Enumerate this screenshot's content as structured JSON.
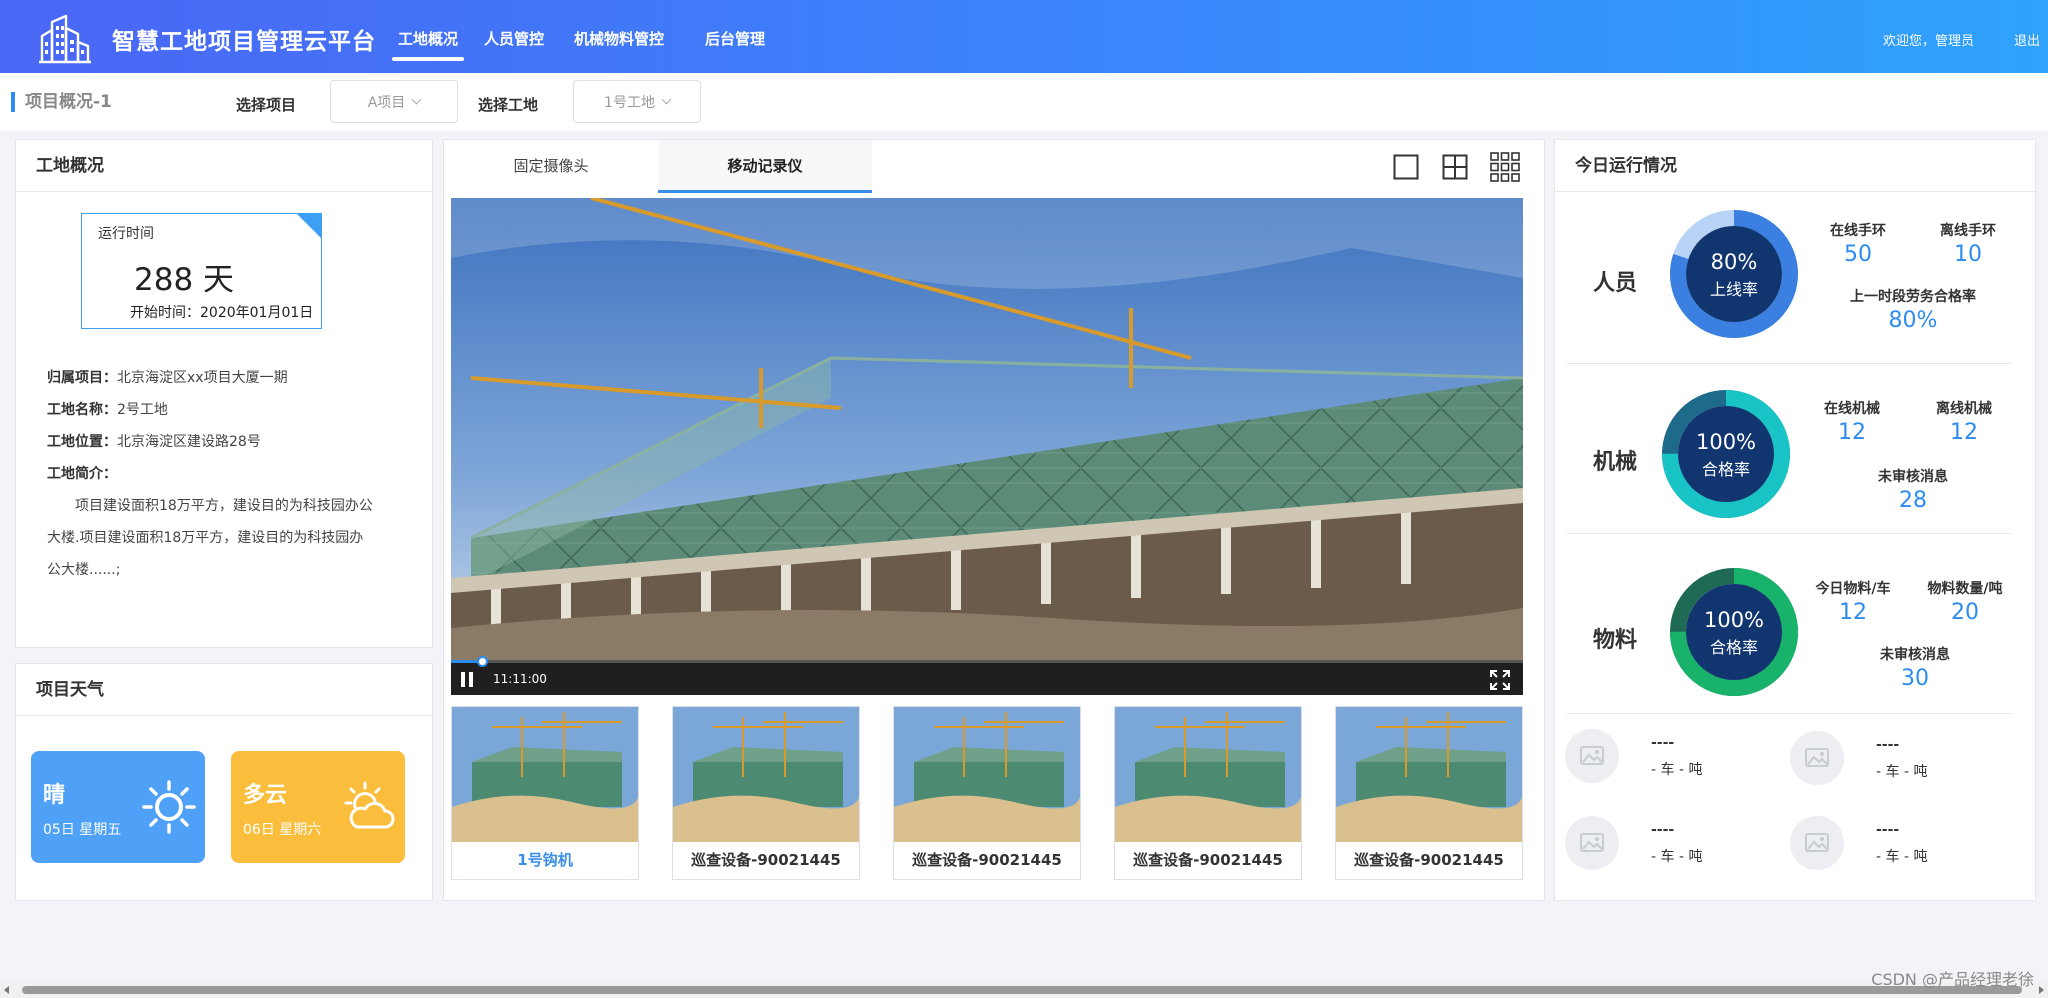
{
  "header": {
    "title": "智慧工地项目管理云平台",
    "nav": [
      "工地概况",
      "人员管控",
      "机械物料管控",
      "后台管理"
    ],
    "active_nav": "工地概况",
    "welcome": "欢迎您，管理员",
    "logout": "退出"
  },
  "subbar": {
    "breadcrumb": "项目概况-1",
    "project_label": "选择项目",
    "project_value": "A项目",
    "site_label": "选择工地",
    "site_value": "1号工地"
  },
  "overview": {
    "title": "工地概况",
    "runtime_label": "运行时间",
    "runtime_value": "288 天",
    "start_time": "开始时间：2020年01月01日",
    "project_key": "归属项目：",
    "project_value": "北京海淀区xx项目大厦一期",
    "site_name_key": "工地名称：",
    "site_name_value": "2号工地",
    "site_location_key": "工地位置：",
    "site_location_value": "北京海淀区建设路28号",
    "intro_key": "工地简介：",
    "intro_text": "项目建设面积18万平方，建设目的为科技园办公大楼.项目建设面积18万平方，建设目的为科技园办公大楼......;"
  },
  "weather": {
    "title": "项目天气",
    "days": [
      {
        "condition": "晴",
        "date": "05日 星期五",
        "color": "#4ea1f7",
        "icon": "sun-icon"
      },
      {
        "condition": "多云",
        "date": "06日 星期六",
        "color": "#fbbd3c",
        "icon": "cloudy-icon"
      }
    ]
  },
  "video": {
    "tabs": [
      "固定摄像头",
      "移动记录仪"
    ],
    "active_tab": "移动记录仪",
    "layout_icons": [
      "single-layout-icon",
      "quad-layout-icon",
      "nine-layout-icon"
    ],
    "time": "11:11:00",
    "progress": 0.03,
    "thumbnails": [
      "1号钩机",
      "巡查设备-90021445",
      "巡查设备-90021445",
      "巡查设备-90021445",
      "巡查设备-90021445"
    ]
  },
  "today": {
    "title": "今日运行情况",
    "blocks": [
      {
        "name": "人员",
        "ring_value": "80%",
        "ring_label": "上线率",
        "ring_percent": 0.8,
        "ring_color": "#3b7fe0",
        "metrics": [
          {
            "label": "在线手环",
            "value": "50"
          },
          {
            "label": "离线手环",
            "value": "10"
          },
          {
            "label": "上一时段劳务合格率",
            "value": "80%"
          }
        ]
      },
      {
        "name": "机械",
        "ring_value": "100%",
        "ring_label": "合格率",
        "ring_percent": 0.75,
        "ring_color": "#19c4c6",
        "metrics": [
          {
            "label": "在线机械",
            "value": "12"
          },
          {
            "label": "离线机械",
            "value": "12"
          },
          {
            "label": "未审核消息",
            "value": "28"
          }
        ]
      },
      {
        "name": "物料",
        "ring_value": "100%",
        "ring_label": "合格率",
        "ring_percent": 0.75,
        "ring_color": "#18b26a",
        "metrics": [
          {
            "label": "今日物料/车",
            "value": "12"
          },
          {
            "label": "物料数量/吨",
            "value": "20"
          },
          {
            "label": "未审核消息",
            "value": "30"
          }
        ]
      }
    ],
    "devices": [
      {
        "name": "----",
        "unit": "- 车   - 吨"
      },
      {
        "name": "----",
        "unit": "- 车   - 吨"
      },
      {
        "name": "----",
        "unit": "- 车   - 吨"
      },
      {
        "name": "----",
        "unit": "- 车   - 吨"
      }
    ]
  },
  "watermark": "CSDN @产品经理老徐"
}
